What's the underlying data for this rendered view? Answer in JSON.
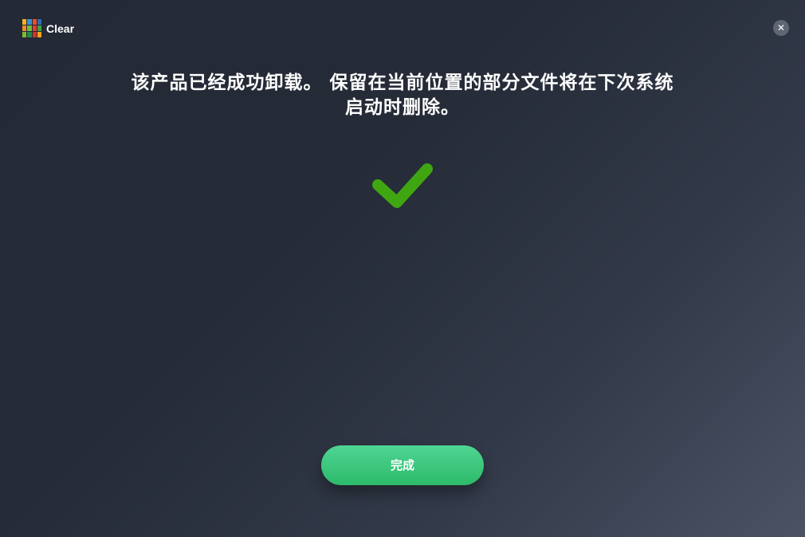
{
  "app": {
    "title": "Clear",
    "logo_icon": "avg-logo-icon"
  },
  "header": {
    "close_icon": "close-icon",
    "close_symbol": "✕"
  },
  "main": {
    "message_line1": "该产品已经成功卸载。 保留在当前位置的部分文件将在下次系统",
    "message_line2": "启动时删除。",
    "status_icon": "checkmark-icon",
    "done_label": "完成"
  },
  "colors": {
    "check_green": "#3fa612",
    "button_green_top": "#4fd593",
    "button_green_bottom": "#2dba6a",
    "background": "#262c38"
  }
}
